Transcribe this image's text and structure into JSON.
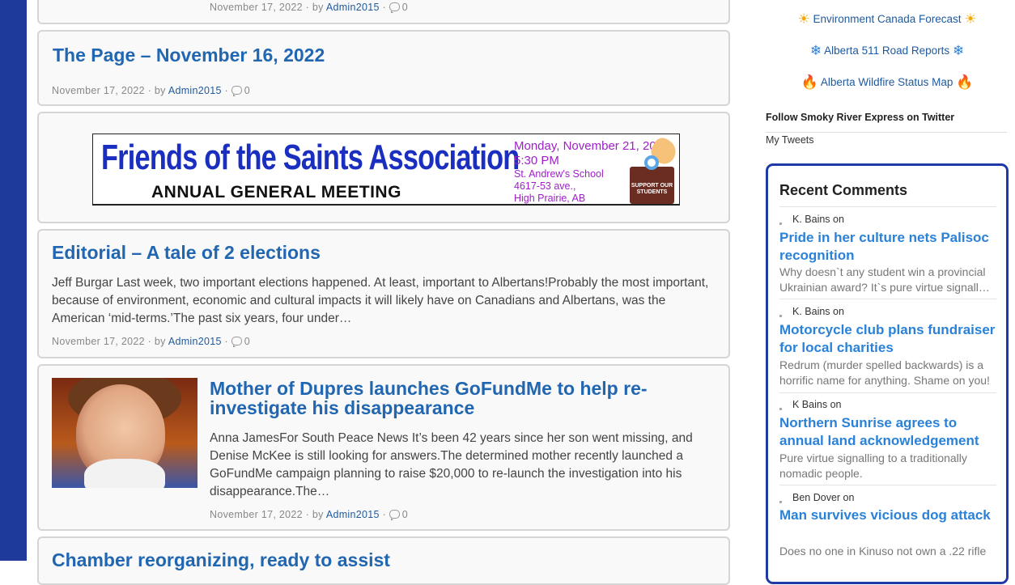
{
  "posts": {
    "prev_meta": {
      "date": "November 17, 2022",
      "by": "· by",
      "author": "Admin2015",
      "count": "0"
    },
    "page": {
      "title": "The Page – November 16, 2022",
      "date": "November 17, 2022",
      "by": "· by",
      "author": "Admin2015",
      "count": "0"
    },
    "ad": {
      "title": "Friends of the Saints Association",
      "subtitle": "ANNUAL GENERAL MEETING",
      "date": "Monday, November 21, 2022",
      "time": "5:30 PM",
      "venue": "St. Andrew's School",
      "address": "4617-53 ave.,",
      "city": "High Prairie, AB",
      "ballot": "SUPPORT OUR STUDENTS"
    },
    "editorial": {
      "title": "Editorial – A tale of 2 elections",
      "excerpt": "Jeff Burgar Last week, two important elections happened. At least, important to Albertans!Probably the most important, because of environment, economic and cultural impacts it will likely have on Canadians and Albertans, was the American ‘mid-terms.’The past six years, four under…",
      "date": "November 17, 2022",
      "by": "· by",
      "author": "Admin2015",
      "count": "0"
    },
    "mother": {
      "title": "Mother of Dupres launches GoFundMe to help re-investigate his disappearance",
      "excerpt": "Anna JamesFor South Peace News It’s been 42 years since her son went missing, and Denise McKee is still looking for answers.The determined mother recently launched a GoFundMe campaign planning to raise $20,000 to re-launch the investigation into his disappearance.The…",
      "date": "November 17, 2022",
      "by": "· by",
      "author": "Admin2015",
      "count": "0"
    },
    "chamber": {
      "title": "Chamber reorganizing, ready to assist"
    }
  },
  "sidebar": {
    "links": [
      {
        "label": "Environment Canada Forecast",
        "icon": "sun-icon"
      },
      {
        "label": "Alberta 511 Road Reports",
        "icon": "snowflake-icon"
      },
      {
        "label": "Alberta Wildfire Status Map",
        "icon": "fire-icon"
      }
    ],
    "follow": "Follow Smoky River Express on Twitter",
    "tweets": "My Tweets",
    "recent": {
      "title": "Recent Comments",
      "items": [
        {
          "author": "K. Bains",
          "on": "on",
          "post": "Pride in her culture nets Palisoc recognition",
          "snippet": "Why doesn`t any student win a provincial Ukrainian award? It`s pure virtue signall…"
        },
        {
          "author": "K. Bains",
          "on": "on",
          "post": "Motorcycle club plans fundraiser for local charities",
          "snippet": "Redrum (murder spelled backwards) is a horrific name for anything. Shame on you!"
        },
        {
          "author": "K Bains",
          "on": "on",
          "post": "Northern Sunrise agrees to annual land acknowledgement",
          "snippet": "Pure virtue signalling to a traditionally nomadic people."
        },
        {
          "author": "Ben Dover",
          "on": "on",
          "post": "Man survives vicious dog attack",
          "snippet": "Does no one in Kinuso not own a .22 rifle"
        }
      ]
    }
  }
}
